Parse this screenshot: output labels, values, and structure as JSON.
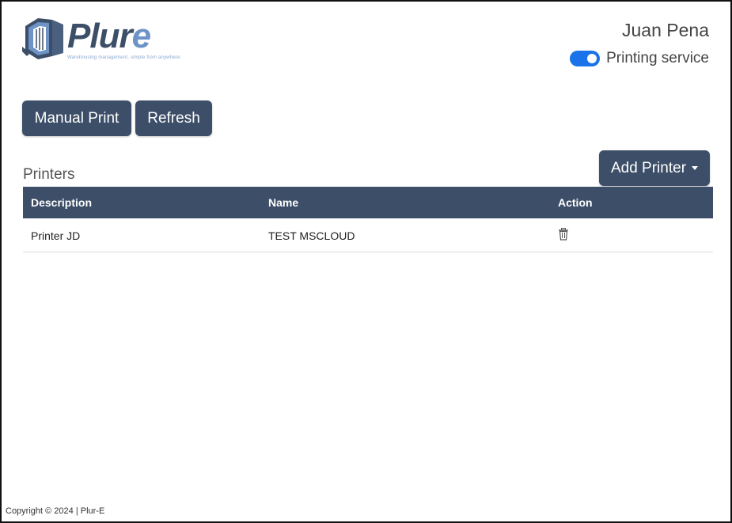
{
  "brand": {
    "logo_text_main": "Plur",
    "logo_text_accent": "e",
    "tagline": "Warehousing management, simple from anywhere"
  },
  "header": {
    "user_name": "Juan Pena",
    "printing_service_label": "Printing service",
    "printing_service_enabled": true
  },
  "toolbar": {
    "manual_print_label": "Manual Print",
    "refresh_label": "Refresh",
    "add_printer_label": "Add Printer"
  },
  "printers": {
    "title": "Printers",
    "columns": [
      "Description",
      "Name",
      "Action"
    ],
    "rows": [
      {
        "description": "Printer JD",
        "name": "TEST MSCLOUD",
        "action_icon": "trash-icon"
      }
    ]
  },
  "footer": {
    "copyright": "Copyright © 2024 | Plur-E"
  },
  "colors": {
    "primary": "#3d4f68",
    "toggle_on": "#1a73e8",
    "logo_accent": "#6d93c7"
  }
}
